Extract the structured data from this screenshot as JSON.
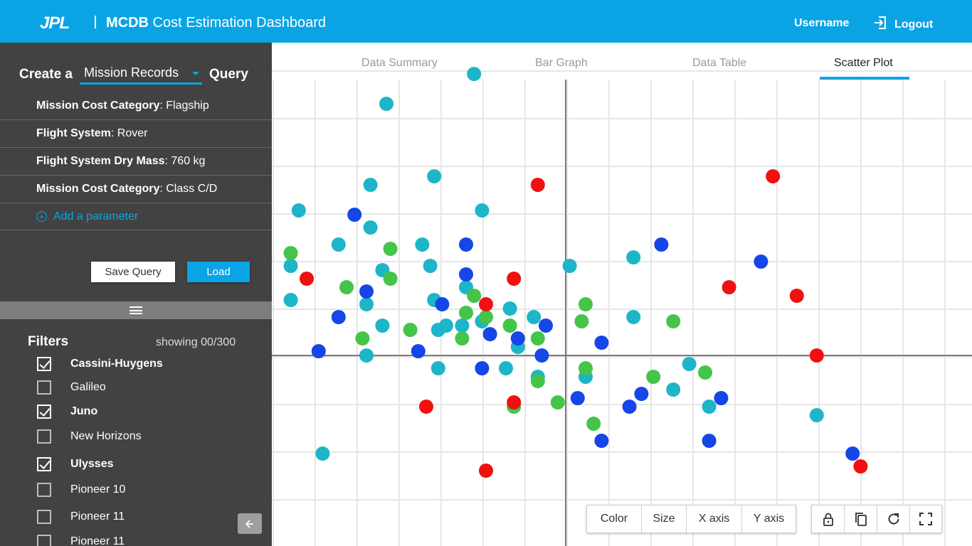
{
  "header": {
    "logo": "JPL",
    "title_bold": "MCDB",
    "title_rest": " Cost Estimation Dashboard",
    "username": "Username",
    "logout_label": "Logout"
  },
  "query": {
    "prefix": "Create a",
    "selected": "Mission Records",
    "suffix": "Query",
    "params": [
      {
        "key": "Mission Cost Category",
        "value": ": Flagship"
      },
      {
        "key": "Flight System",
        "value": ": Rover"
      },
      {
        "key": "Flight System Dry Mass",
        "value": ": 760 kg"
      },
      {
        "key": "Mission Cost Category",
        "value": ": Class C/D"
      }
    ],
    "add_label": "Add a parameter",
    "save_label": "Save Query",
    "load_label": "Load"
  },
  "filters": {
    "title": "Filters",
    "showing": "showing 00/300",
    "items": [
      {
        "label": "Cassini-Huygens",
        "checked": true
      },
      {
        "label": "Galileo",
        "checked": false
      },
      {
        "label": "Juno",
        "checked": true
      },
      {
        "label": "New Horizons",
        "checked": false
      },
      {
        "label": "Ulysses",
        "checked": true
      },
      {
        "label": "Pioneer 10",
        "checked": false
      },
      {
        "label": "Pioneer 11",
        "checked": false
      },
      {
        "label": "Pioneer 11",
        "checked": false
      }
    ]
  },
  "tabs": [
    {
      "label": "Data Summary",
      "active": false
    },
    {
      "label": "Bar Graph",
      "active": false
    },
    {
      "label": "Data Table",
      "active": false
    },
    {
      "label": "Scatter Plot",
      "active": true
    }
  ],
  "toolbar": {
    "color_label": "Color",
    "size_label": "Size",
    "xaxis_label": "X axis",
    "yaxis_label": "Y axis",
    "icons": [
      "lock-icon",
      "copy-icon",
      "refresh-icon",
      "fullscreen-icon"
    ]
  },
  "colors": {
    "accent": "#0aa4e4",
    "teal": "#1eb5c9",
    "blue": "#1446e8",
    "green": "#45c44a",
    "red": "#f01010"
  },
  "chart_data": {
    "type": "scatter",
    "title": "",
    "xlabel": "",
    "ylabel": "",
    "grid": true,
    "series": [
      {
        "color": "teal",
        "points": [
          [
            -2.3,
            6.6
          ],
          [
            -4.5,
            5.9
          ],
          [
            -3.3,
            4.2
          ],
          [
            -4.9,
            4.0
          ],
          [
            -6.7,
            3.4
          ],
          [
            -2.1,
            3.4
          ],
          [
            -4.9,
            3.0
          ],
          [
            -5.7,
            2.6
          ],
          [
            -3.6,
            2.6
          ],
          [
            -6.9,
            2.1
          ],
          [
            -3.4,
            2.1
          ],
          [
            -4.6,
            2.0
          ],
          [
            -2.5,
            1.6
          ],
          [
            -6.9,
            1.3
          ],
          [
            -3.3,
            1.3
          ],
          [
            -5.0,
            1.2
          ],
          [
            0.1,
            2.1
          ],
          [
            1.7,
            2.3
          ],
          [
            -1.4,
            1.1
          ],
          [
            -0.8,
            0.9
          ],
          [
            1.7,
            0.9
          ],
          [
            -4.6,
            0.7
          ],
          [
            -3.0,
            0.7
          ],
          [
            -2.6,
            0.7
          ],
          [
            -2.1,
            0.8
          ],
          [
            -3.2,
            0.6
          ],
          [
            -1.2,
            0.2
          ],
          [
            -5.0,
            0.0
          ],
          [
            -3.2,
            -0.3
          ],
          [
            -1.5,
            -0.3
          ],
          [
            -0.7,
            -0.5
          ],
          [
            0.5,
            -0.5
          ],
          [
            3.1,
            -0.2
          ],
          [
            2.7,
            -0.8
          ],
          [
            3.6,
            -1.2
          ],
          [
            6.3,
            -1.4
          ],
          [
            -6.1,
            -2.3
          ]
        ]
      },
      {
        "color": "blue",
        "points": [
          [
            -5.3,
            3.3
          ],
          [
            2.4,
            2.6
          ],
          [
            -2.5,
            2.6
          ],
          [
            -2.5,
            1.9
          ],
          [
            -5.0,
            1.5
          ],
          [
            -3.1,
            1.2
          ],
          [
            4.9,
            2.2
          ],
          [
            -5.7,
            0.9
          ],
          [
            -0.5,
            0.7
          ],
          [
            -1.9,
            0.5
          ],
          [
            -1.2,
            0.4
          ],
          [
            0.9,
            0.3
          ],
          [
            -6.2,
            0.1
          ],
          [
            -3.7,
            0.1
          ],
          [
            -0.6,
            0.0
          ],
          [
            -2.1,
            -0.3
          ],
          [
            1.9,
            -0.9
          ],
          [
            0.3,
            -1.0
          ],
          [
            1.6,
            -1.2
          ],
          [
            3.9,
            -1.0
          ],
          [
            0.9,
            -2.0
          ],
          [
            3.6,
            -2.0
          ],
          [
            7.2,
            -2.3
          ]
        ]
      },
      {
        "color": "green",
        "points": [
          [
            -6.9,
            2.4
          ],
          [
            -4.4,
            2.5
          ],
          [
            -4.4,
            1.8
          ],
          [
            -5.5,
            1.6
          ],
          [
            -2.3,
            1.4
          ],
          [
            -2.5,
            1.0
          ],
          [
            -2.0,
            0.9
          ],
          [
            -1.4,
            0.7
          ],
          [
            -3.9,
            0.6
          ],
          [
            0.5,
            1.2
          ],
          [
            0.4,
            0.8
          ],
          [
            2.7,
            0.8
          ],
          [
            -5.1,
            0.4
          ],
          [
            -2.6,
            0.4
          ],
          [
            -0.7,
            0.4
          ],
          [
            0.5,
            -0.3
          ],
          [
            -0.7,
            -0.6
          ],
          [
            2.2,
            -0.5
          ],
          [
            3.5,
            -0.4
          ],
          [
            -1.3,
            -1.2
          ],
          [
            -0.2,
            -1.1
          ],
          [
            0.7,
            -1.6
          ]
        ]
      },
      {
        "color": "red",
        "points": [
          [
            -0.7,
            4.0
          ],
          [
            5.2,
            4.2
          ],
          [
            -6.5,
            1.8
          ],
          [
            -1.3,
            1.8
          ],
          [
            -2.0,
            1.2
          ],
          [
            4.1,
            1.6
          ],
          [
            5.8,
            1.4
          ],
          [
            6.3,
            0.0
          ],
          [
            -3.5,
            -1.2
          ],
          [
            -1.3,
            -1.1
          ],
          [
            -2.0,
            -2.7
          ],
          [
            7.4,
            -2.6
          ]
        ]
      }
    ]
  }
}
